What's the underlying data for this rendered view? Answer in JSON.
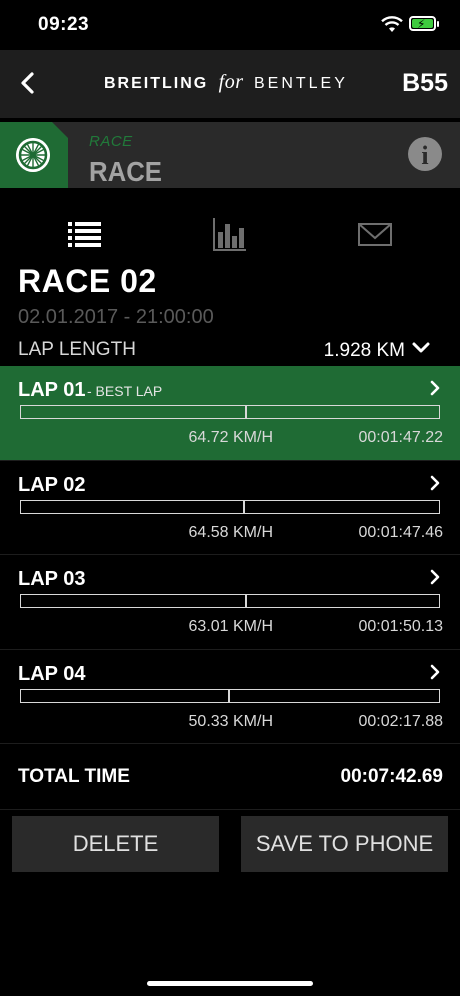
{
  "status_bar": {
    "time": "09:23",
    "wifi_icon": "wifi-icon",
    "battery_icon": "battery-charging-icon"
  },
  "nav": {
    "back_icon": "chevron-left-icon",
    "brand_breitling": "BREITLING",
    "brand_for": "for",
    "brand_bentley": "BENTLEY",
    "model": "B55"
  },
  "mode": {
    "icon": "wheel-icon",
    "label_small": "RACE",
    "label_large": "RACE",
    "info_icon": "info-icon",
    "info_glyph": "i"
  },
  "tabs": [
    {
      "name": "list",
      "icon": "list-icon",
      "active": true
    },
    {
      "name": "chart",
      "icon": "bar-chart-icon",
      "active": false
    },
    {
      "name": "mail",
      "icon": "envelope-icon",
      "active": false
    }
  ],
  "race": {
    "title": "RACE 02",
    "date": "02.01.2017 - 21:00:00"
  },
  "lap_length": {
    "label": "LAP LENGTH",
    "value": "1.928 KM"
  },
  "laps": [
    {
      "name": "LAP 01",
      "tag": "- BEST LAP",
      "speed": "64.72 KM/H",
      "time": "00:01:47.22",
      "progress": 0.535,
      "best": true
    },
    {
      "name": "LAP 02",
      "tag": "",
      "speed": "64.58 KM/H",
      "time": "00:01:47.46",
      "progress": 0.53,
      "best": false
    },
    {
      "name": "LAP 03",
      "tag": "",
      "speed": "63.01 KM/H",
      "time": "00:01:50.13",
      "progress": 0.535,
      "best": false
    },
    {
      "name": "LAP 04",
      "tag": "",
      "speed": "50.33 KM/H",
      "time": "00:02:17.88",
      "progress": 0.495,
      "best": false
    }
  ],
  "total": {
    "label": "TOTAL TIME",
    "value": "00:07:42.69"
  },
  "actions": {
    "delete": "DELETE",
    "save": "SAVE TO PHONE"
  },
  "colors": {
    "accent": "#1f6b34",
    "accent_text": "#217a3a",
    "panel": "#2a2a2a",
    "nav": "#1e1e1e"
  }
}
